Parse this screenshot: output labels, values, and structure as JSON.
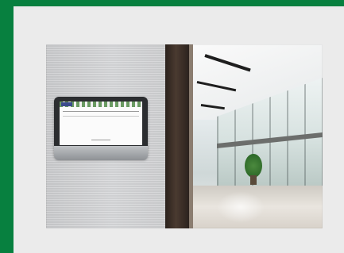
{
  "photo": {
    "subject": "wall-mounted-tablet-in-lobby",
    "colors": {
      "frame": "#07803f",
      "panel": "#ebebeb",
      "pillar": "#3a2d25"
    }
  }
}
